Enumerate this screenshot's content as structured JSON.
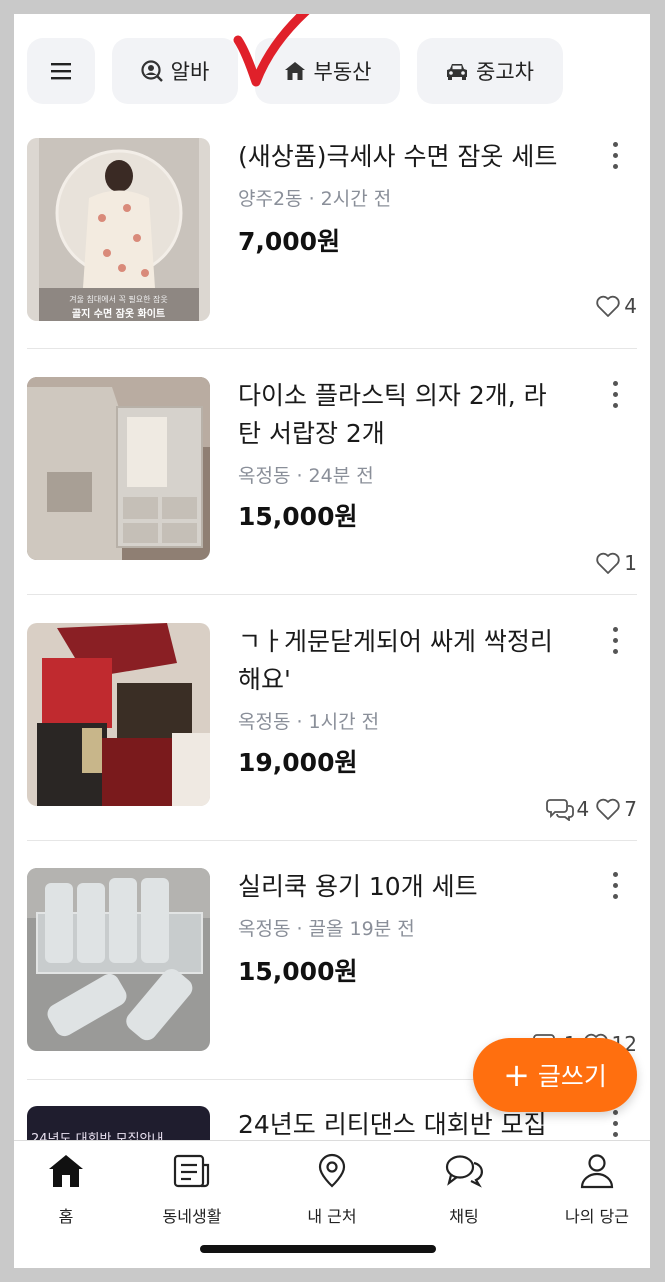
{
  "chips": [
    {
      "label": "",
      "icon": "menu-icon"
    },
    {
      "label": "알바",
      "icon": "person-search-icon"
    },
    {
      "label": "부동산",
      "icon": "house-icon"
    },
    {
      "label": "중고차",
      "icon": "car-icon"
    }
  ],
  "items": [
    {
      "title": "(새상품)극세사 수면 잠옷 세트",
      "meta": "양주2동 · 2시간 전",
      "price": "7,000원",
      "likes": "4",
      "chats": "",
      "thumb_caption_small": "겨울 침대에서 꼭 필요한 잠옷",
      "thumb_caption": "골지 수면 잠옷 화이트"
    },
    {
      "title": "다이소 플라스틱 의자 2개, 라탄 서랍장 2개",
      "meta": "옥정동 · 24분 전",
      "price": "15,000원",
      "likes": "1",
      "chats": ""
    },
    {
      "title": "ㄱㅏ게문닫게되어 싸게 싹정리해요'",
      "meta": "옥정동 · 1시간 전",
      "price": "19,000원",
      "likes": "7",
      "chats": "4"
    },
    {
      "title": "실리쿡 용기 10개 세트",
      "meta": "옥정동 · 끌올 19분 전",
      "price": "15,000원",
      "likes": "12",
      "chats": "1"
    },
    {
      "title": "24년도 리티댄스 대회반 모집",
      "meta": "",
      "price": "",
      "likes": "",
      "chats": "",
      "thumb_caption": "24년도 대회반 모집안내"
    }
  ],
  "fab": {
    "label": "글쓰기"
  },
  "nav": [
    {
      "label": "홈",
      "icon": "home-icon"
    },
    {
      "label": "동네생활",
      "icon": "newspaper-icon"
    },
    {
      "label": "내 근처",
      "icon": "location-pin-icon"
    },
    {
      "label": "채팅",
      "icon": "chat-bubbles-icon"
    },
    {
      "label": "나의 당근",
      "icon": "person-icon"
    }
  ],
  "colors": {
    "accent": "#ff6f0f",
    "annotation": "#e0202a"
  }
}
